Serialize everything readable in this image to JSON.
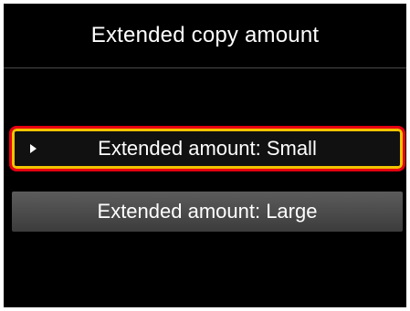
{
  "screen": {
    "title": "Extended copy amount"
  },
  "menu": {
    "items": [
      {
        "label": "Extended amount: Small",
        "selected": true
      },
      {
        "label": "Extended amount: Large",
        "selected": false
      }
    ]
  },
  "colors": {
    "background": "#000000",
    "text": "#ffffff",
    "selection_outer": "#e60012",
    "selection_inner": "#f2c400",
    "item_background": "#4a4a4a"
  },
  "icons": {
    "cursor": "play-triangle-icon"
  }
}
